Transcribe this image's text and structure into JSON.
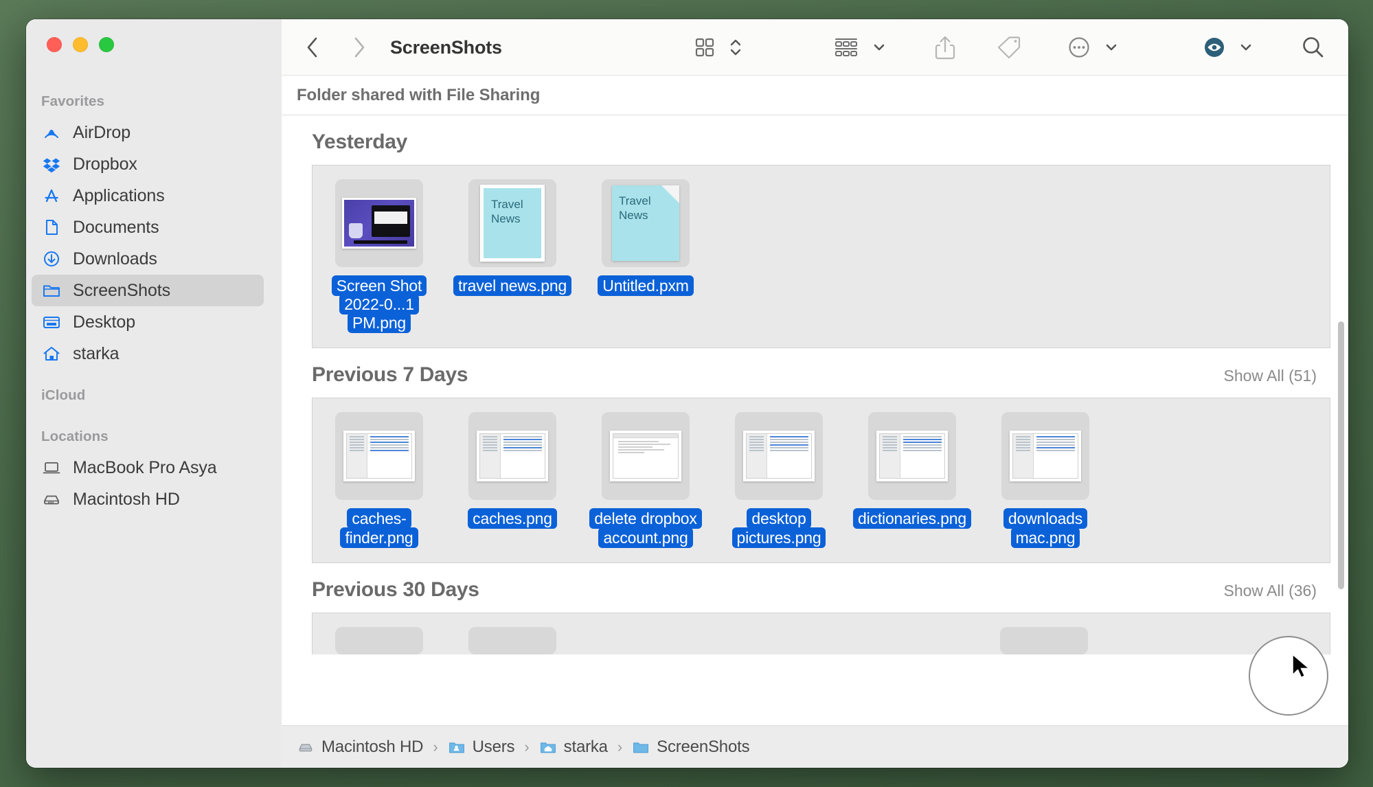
{
  "window": {
    "title": "ScreenShots",
    "traffic_lights": [
      "close",
      "minimize",
      "zoom"
    ]
  },
  "toolbar": {
    "back_label": "Back",
    "forward_label": "Forward",
    "title": "ScreenShots",
    "icon_view_label": "Icon View",
    "group_by_label": "Group By",
    "share_label": "Share",
    "tags_label": "Tags",
    "more_label": "More",
    "quicklook_label": "Quick Look",
    "search_label": "Search",
    "accent_color": "#2d5f78"
  },
  "share_banner": {
    "text": "Folder shared with File Sharing"
  },
  "groups": [
    {
      "title": "Yesterday",
      "show_all": "",
      "files": [
        {
          "name": "Screen Shot 2022-0...1 PM.png",
          "kind": "screenshot",
          "selected": true
        },
        {
          "name": "travel news.png",
          "kind": "travel-png",
          "selected": true,
          "thumb_text": "Travel News"
        },
        {
          "name": "Untitled.pxm",
          "kind": "travel-pxm",
          "selected": true,
          "thumb_text": "Travel News"
        }
      ]
    },
    {
      "title": "Previous 7 Days",
      "show_all": "Show All (51)",
      "files": [
        {
          "name": "caches-finder.png",
          "kind": "finder-window",
          "selected": true
        },
        {
          "name": "caches.png",
          "kind": "finder-window",
          "selected": true
        },
        {
          "name": "delete dropbox account.png",
          "kind": "doc-window",
          "selected": true
        },
        {
          "name": "desktop pictures.png",
          "kind": "finder-window",
          "selected": true
        },
        {
          "name": "dictionaries.png",
          "kind": "finder-window",
          "selected": true
        },
        {
          "name": "downloads mac.png",
          "kind": "finder-window",
          "selected": true
        }
      ]
    },
    {
      "title": "Previous 30 Days",
      "show_all": "Show All (36)",
      "files": [
        {
          "name": "",
          "kind": "partial",
          "selected": false
        },
        {
          "name": "",
          "kind": "partial",
          "selected": false
        },
        {
          "name": "",
          "kind": "partial",
          "selected": false
        }
      ]
    }
  ],
  "sidebar": {
    "sections": [
      {
        "title": "Favorites",
        "items": [
          {
            "label": "AirDrop",
            "icon": "airdrop-icon",
            "selected": false
          },
          {
            "label": "Dropbox",
            "icon": "dropbox-icon",
            "selected": false
          },
          {
            "label": "Applications",
            "icon": "applications-icon",
            "selected": false
          },
          {
            "label": "Documents",
            "icon": "documents-icon",
            "selected": false
          },
          {
            "label": "Downloads",
            "icon": "downloads-icon",
            "selected": false
          },
          {
            "label": "ScreenShots",
            "icon": "folder-icon",
            "selected": true
          },
          {
            "label": "Desktop",
            "icon": "desktop-icon",
            "selected": false
          },
          {
            "label": "starka",
            "icon": "home-icon",
            "selected": false
          }
        ]
      },
      {
        "title": "iCloud",
        "items": []
      },
      {
        "title": "Locations",
        "items": [
          {
            "label": "MacBook Pro Asya",
            "icon": "laptop-icon",
            "selected": false
          },
          {
            "label": "Macintosh HD",
            "icon": "harddisk-icon",
            "selected": false
          }
        ]
      }
    ]
  },
  "pathbar": {
    "items": [
      {
        "label": "Macintosh HD",
        "icon": "harddisk-icon"
      },
      {
        "label": "Users",
        "icon": "folder-users-icon"
      },
      {
        "label": "starka",
        "icon": "folder-home-icon"
      },
      {
        "label": "ScreenShots",
        "icon": "folder-icon"
      }
    ],
    "separator": "›"
  }
}
